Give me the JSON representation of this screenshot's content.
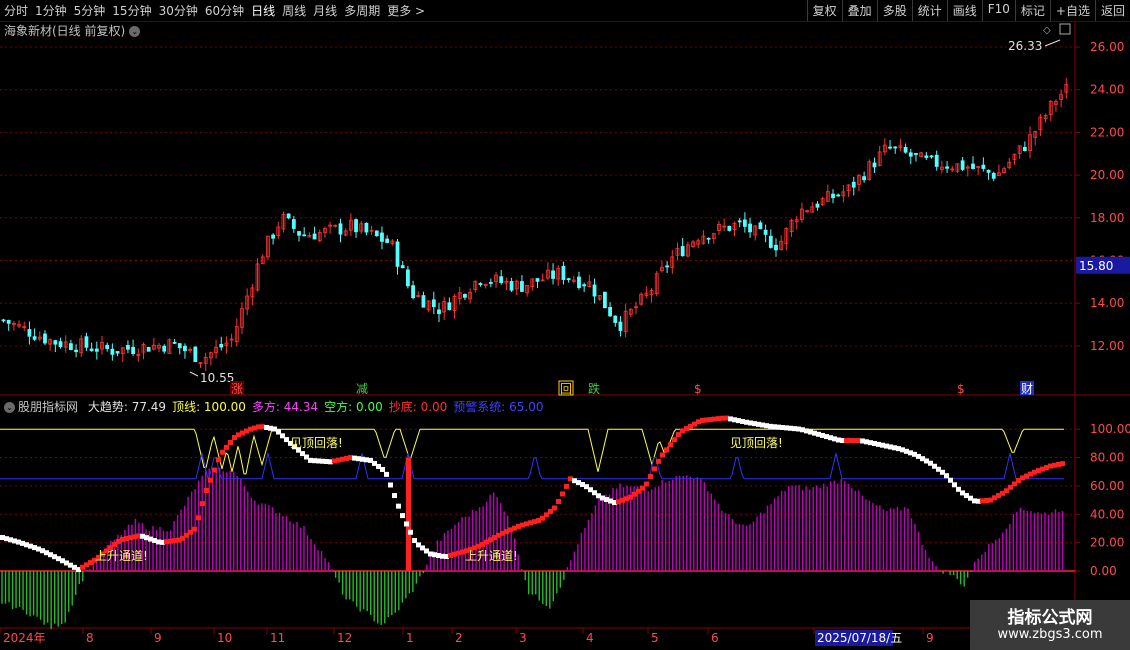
{
  "toolbar": {
    "periods": [
      "分时",
      "1分钟",
      "5分钟",
      "15分钟",
      "30分钟",
      "60分钟",
      "日线",
      "周线",
      "月线",
      "多周期",
      "更多"
    ],
    "active": "日线",
    "more_suffix": ">",
    "right": [
      "复权",
      "叠加",
      "多股",
      "统计",
      "画线",
      "F10",
      "标记",
      "+自选",
      "返回"
    ]
  },
  "main_chart": {
    "title": "海象新材(日线 前复权)",
    "price_axis": [
      "26.00",
      "24.00",
      "22.00",
      "20.00",
      "18.00",
      "16.00",
      "14.00",
      "12.00"
    ],
    "current_price": "15.80",
    "high_label": "26.33",
    "low_label": "10.55",
    "markers": [
      {
        "text": "涨",
        "color": "#ff4a4a"
      },
      {
        "text": "减",
        "color": "#40d040"
      },
      {
        "text": "回",
        "color": "#ffd000"
      },
      {
        "text": "跌",
        "color": "#40d040"
      },
      {
        "text": "$",
        "color": "#ff4a4a"
      },
      {
        "text": "$",
        "color": "#ff4a4a"
      },
      {
        "text": "财",
        "color": "#ffffff"
      }
    ]
  },
  "indicator": {
    "name": "股朋指标网",
    "items": [
      {
        "label": "大趋势:",
        "value": "77.49",
        "color": "#e0e0e0"
      },
      {
        "label": "顶线:",
        "value": "100.00",
        "color": "#ffff40"
      },
      {
        "label": "多方:",
        "value": "44.34",
        "color": "#ff40ff"
      },
      {
        "label": "空方:",
        "value": "0.00",
        "color": "#40ff40"
      },
      {
        "label": "抄底:",
        "value": "0.00",
        "color": "#ff3030"
      },
      {
        "label": "预警系统:",
        "value": "65.00",
        "color": "#4040ff"
      }
    ],
    "axis": [
      "100.00",
      "80.00",
      "60.00",
      "40.00",
      "20.00",
      "0.00"
    ],
    "annotations": [
      "上升通道!",
      "见顶回落!",
      "上升通道!",
      "见顶回落!"
    ]
  },
  "date_axis": {
    "labels": [
      "2024年",
      "8",
      "9",
      "10",
      "11",
      "12",
      "1",
      "2",
      "3",
      "4",
      "5",
      "6",
      "2025/07/18/五",
      "9"
    ]
  },
  "watermark": {
    "line1": "指标公式网",
    "line2": "www.zbgs3.com"
  },
  "colors": {
    "up": "#ff3232",
    "down": "#54ffff",
    "ma": "#ffffff",
    "grid": "#780000"
  }
}
